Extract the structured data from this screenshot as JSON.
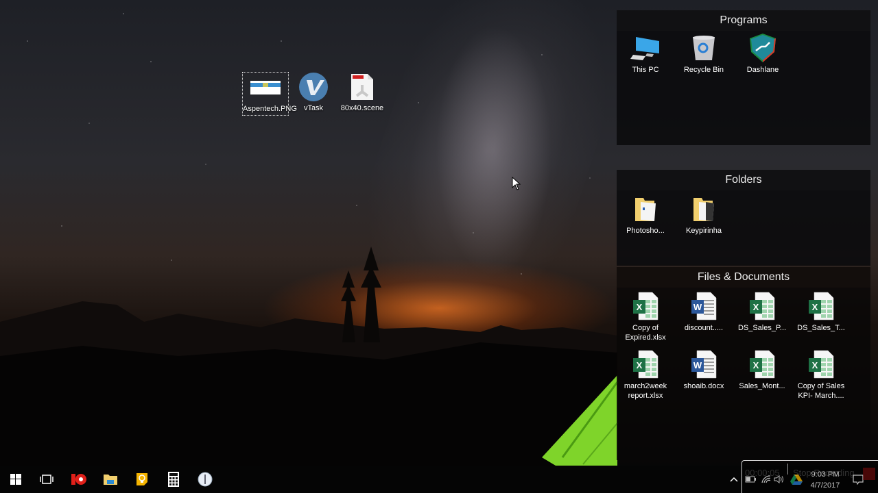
{
  "desktop": {
    "icons": [
      {
        "label": "Aspentech.PNG",
        "icon": "image-file-icon",
        "selected": true
      },
      {
        "label": "vTask",
        "icon": "vtask-app-icon",
        "selected": false
      },
      {
        "label": "80x40.scene",
        "icon": "scene-file-icon",
        "selected": false
      }
    ]
  },
  "fences": {
    "programs": {
      "title": "Programs",
      "items": [
        {
          "label": "This PC",
          "icon": "computer-icon"
        },
        {
          "label": "Recycle Bin",
          "icon": "recycle-bin-icon"
        },
        {
          "label": "Dashlane",
          "icon": "dashlane-icon"
        }
      ]
    },
    "folders": {
      "title": "Folders",
      "items": [
        {
          "label": "Photosho...",
          "icon": "folder-icon"
        },
        {
          "label": "Keypirinha",
          "icon": "folder-icon"
        }
      ]
    },
    "files": {
      "title": "Files & Documents",
      "items": [
        {
          "label": "Copy of Expired.xlsx",
          "type": "excel"
        },
        {
          "label": "discount.....",
          "type": "word"
        },
        {
          "label": "DS_Sales_P...",
          "type": "excel"
        },
        {
          "label": "DS_Sales_T...",
          "type": "excel"
        },
        {
          "label": "march2week report.xlsx",
          "type": "excel"
        },
        {
          "label": "shoaib.docx",
          "type": "word"
        },
        {
          "label": "Sales_Mont...",
          "type": "excel"
        },
        {
          "label": "Copy of Sales KPI- March....",
          "type": "excel"
        }
      ]
    }
  },
  "taskbar": {
    "pinned": [
      {
        "name": "start",
        "icon": "windows-start-icon"
      },
      {
        "name": "task-view",
        "icon": "task-view-icon"
      },
      {
        "name": "recorder",
        "icon": "screen-recorder-icon"
      },
      {
        "name": "file-explorer",
        "icon": "file-explorer-icon"
      },
      {
        "name": "keep",
        "icon": "lightbulb-notes-icon"
      },
      {
        "name": "calculator",
        "icon": "calculator-icon"
      },
      {
        "name": "clock",
        "icon": "clock-icon"
      }
    ],
    "tray": {
      "time": "9:03 PM",
      "date": "4/7/2017"
    },
    "recording": {
      "elapsed": "00:00:05",
      "stop_label": "Stop Recording"
    }
  },
  "colors": {
    "excel": "#1e7145",
    "word": "#2b579a",
    "folder": "#f1cf6e",
    "recorder": "#e0201a"
  }
}
